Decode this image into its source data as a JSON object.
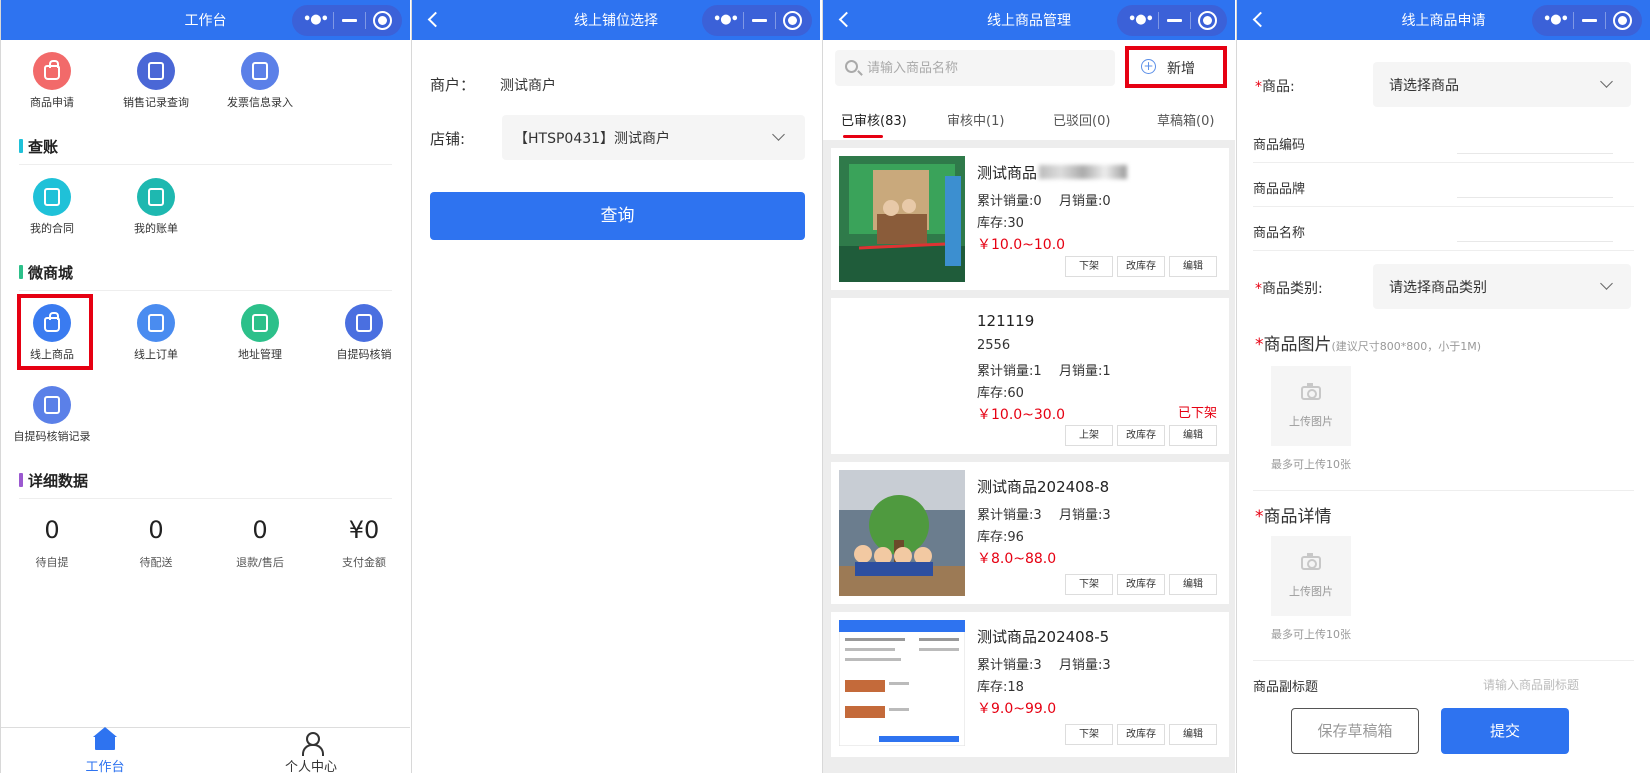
{
  "panel1": {
    "title": "工作台",
    "top_items": [
      {
        "label": "商品申请",
        "icon": "bag-icon",
        "color": "#f26a6a"
      },
      {
        "label": "销售记录查询",
        "icon": "search-list-icon",
        "color": "#4a67d6"
      },
      {
        "label": "发票信息录入",
        "icon": "invoice-icon",
        "color": "#5b80e8"
      }
    ],
    "section_account": "查账",
    "account_items": [
      {
        "label": "我的合同",
        "icon": "contract-icon",
        "color": "#1fc1d8"
      },
      {
        "label": "我的账单",
        "icon": "bill-icon",
        "color": "#1eb8b0"
      }
    ],
    "section_mall": "微商城",
    "mall_items": [
      {
        "label": "线上商品",
        "icon": "online-goods-icon",
        "color": "#3a7bf0"
      },
      {
        "label": "线上订单",
        "icon": "online-order-icon",
        "color": "#4a8cf0"
      },
      {
        "label": "地址管理",
        "icon": "address-icon",
        "color": "#2cc08a"
      },
      {
        "label": "自提码核销",
        "icon": "pickup-code-icon",
        "color": "#4a6fe0"
      },
      {
        "label": "自提码核销记录",
        "icon": "pickup-record-icon",
        "color": "#5b80e8"
      }
    ],
    "section_data": "详细数据",
    "stats": [
      {
        "value": "0",
        "label": "待自提"
      },
      {
        "value": "0",
        "label": "待配送"
      },
      {
        "value": "0",
        "label": "退款/售后"
      },
      {
        "value": "¥0",
        "label": "支付金额"
      }
    ],
    "tabbar": {
      "home": "工作台",
      "me": "个人中心"
    },
    "colors": {
      "accent": "#2e73f0",
      "highlight": "#e60012"
    }
  },
  "panel2": {
    "title": "线上铺位选择",
    "merchant_label": "商户：",
    "merchant_value": "测试商户",
    "shop_label": "店铺:",
    "shop_value": "【HTSP0431】测试商户",
    "query_button": "查询"
  },
  "panel3": {
    "title": "线上商品管理",
    "search_placeholder": "请输入商品名称",
    "add_button": "新增",
    "tabs": [
      "已审核(83)",
      "审核中(1)",
      "已驳回(0)",
      "草稿箱(0)"
    ],
    "products": [
      {
        "name": "测试商品",
        "code": "",
        "total_sales": "累计销量:0",
        "monthly_sales": "月销量:0",
        "stock": "库存:30",
        "price": "￥10.0~10.0",
        "status": "",
        "btn1": "下架",
        "btn2": "改库存",
        "btn3": "编辑"
      },
      {
        "name": "121119",
        "code": "2556",
        "total_sales": "累计销量:1",
        "monthly_sales": "月销量:1",
        "stock": "库存:60",
        "price": "￥10.0~30.0",
        "status": "已下架",
        "btn1": "上架",
        "btn2": "改库存",
        "btn3": "编辑"
      },
      {
        "name": "测试商品202408-8",
        "code": "",
        "total_sales": "累计销量:3",
        "monthly_sales": "月销量:3",
        "stock": "库存:96",
        "price": "￥8.0~88.0",
        "status": "",
        "btn1": "下架",
        "btn2": "改库存",
        "btn3": "编辑"
      },
      {
        "name": "测试商品202408-5",
        "code": "",
        "total_sales": "累计销量:3",
        "monthly_sales": "月销量:3",
        "stock": "库存:18",
        "price": "￥9.0~99.0",
        "status": "",
        "btn1": "下架",
        "btn2": "改库存",
        "btn3": "编辑"
      }
    ]
  },
  "panel4": {
    "title": "线上商品申请",
    "product_label": "商品:",
    "product_placeholder": "请选择商品",
    "code_label": "商品编码",
    "brand_label": "商品品牌",
    "name_label": "商品名称",
    "category_label": "商品类别:",
    "category_placeholder": "请选择商品类别",
    "images_label": "商品图片",
    "images_hint": "(建议尺寸800*800，小于1M)",
    "upload_text": "上传图片",
    "upload_limit": "最多可上传10张",
    "detail_label": "商品详情",
    "subtitle_label": "商品副标题",
    "subtitle_placeholder": "请输入商品副标题",
    "save_draft_button": "保存草稿箱",
    "submit_button": "提交"
  }
}
